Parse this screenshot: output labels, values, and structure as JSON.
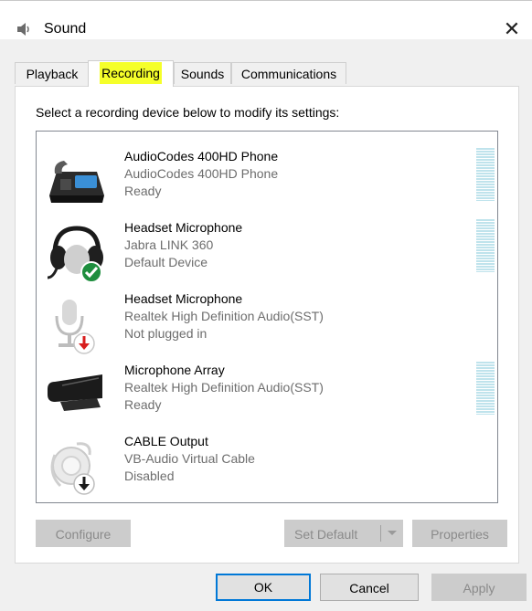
{
  "window": {
    "title": "Sound",
    "close_label": "✕"
  },
  "tabs": [
    {
      "label": "Playback",
      "active": false
    },
    {
      "label": "Recording",
      "active": true
    },
    {
      "label": "Sounds",
      "active": false
    },
    {
      "label": "Communications",
      "active": false
    }
  ],
  "instruction": "Select a recording device below to modify its settings:",
  "devices": [
    {
      "name": "AudioCodes 400HD Phone",
      "description": "AudioCodes 400HD Phone",
      "status": "Ready",
      "icon": "desk-phone-icon",
      "has_level_meter": true
    },
    {
      "name": "Headset Microphone",
      "description": "Jabra LINK 360",
      "status": "Default Device",
      "icon": "headset-icon",
      "badge": "default-checkmark",
      "has_level_meter": true
    },
    {
      "name": "Headset Microphone",
      "description": "Realtek High Definition Audio(SST)",
      "status": "Not plugged in",
      "icon": "microphone-icon",
      "badge": "unplugged-arrow",
      "has_level_meter": false
    },
    {
      "name": "Microphone Array",
      "description": "Realtek High Definition Audio(SST)",
      "status": "Ready",
      "icon": "microphone-array-icon",
      "has_level_meter": true
    },
    {
      "name": "CABLE Output",
      "description": "VB-Audio Virtual Cable",
      "status": "Disabled",
      "icon": "cable-device-icon",
      "badge": "disabled-arrow",
      "has_level_meter": false
    }
  ],
  "panel_buttons": {
    "configure": "Configure",
    "set_default": "Set Default",
    "properties": "Properties"
  },
  "dialog_buttons": {
    "ok": "OK",
    "cancel": "Cancel",
    "apply": "Apply"
  },
  "colors": {
    "highlight": "#f5ff2a",
    "accent": "#0078d7",
    "check_green": "#1e8e3e",
    "warning_red": "#d81e1e",
    "level_meter": "#bfe3ec"
  }
}
